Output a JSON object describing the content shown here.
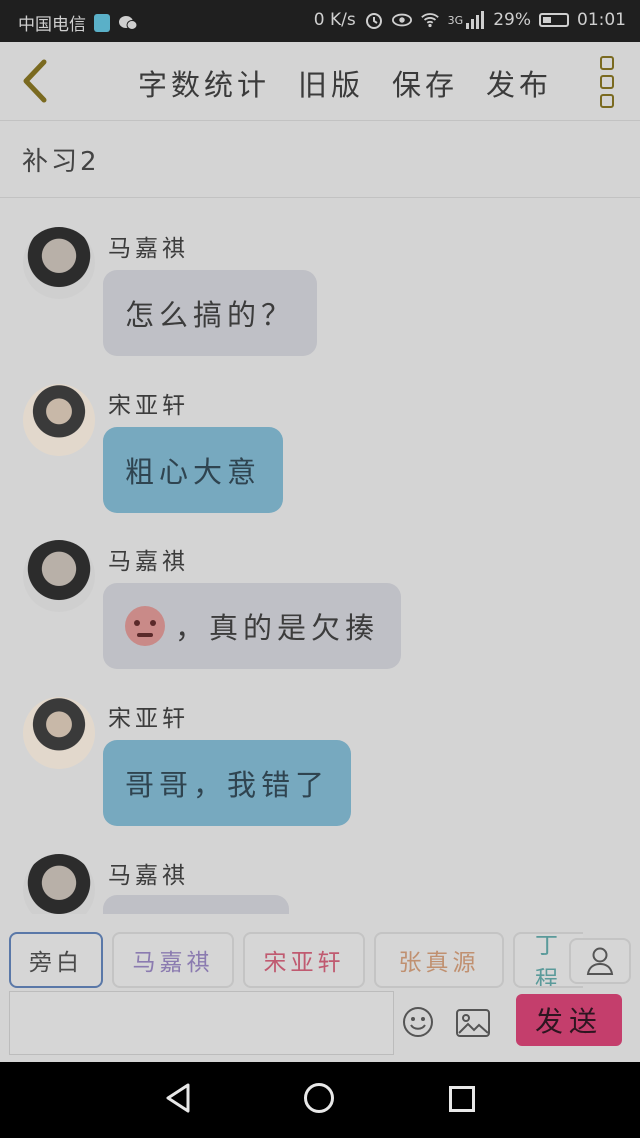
{
  "status": {
    "carrier": "中国电信",
    "speed": "0 K/s",
    "network": "3G",
    "battery_percent": "29%",
    "time": "01:01"
  },
  "header": {
    "actions": [
      "字数统计",
      "旧版",
      "保存",
      "发布"
    ],
    "accent_color": "#7a6a20"
  },
  "chapter_title": "补习2",
  "messages": [
    {
      "speaker": "马嘉祺",
      "text": "怎么搞的？",
      "side": "gray"
    },
    {
      "speaker": "宋亚轩",
      "text": "粗心大意",
      "side": "blue"
    },
    {
      "speaker": "马嘉祺",
      "text": "，真的是欠揍",
      "side": "gray",
      "emoji": "angry-face"
    },
    {
      "speaker": "宋亚轩",
      "text": "哥哥，我错了",
      "side": "blue"
    },
    {
      "speaker": "马嘉祺",
      "text": "",
      "side": "gray"
    }
  ],
  "roles": [
    "旁白",
    "马嘉祺",
    "宋亚轩",
    "张真源",
    "丁程"
  ],
  "input": {
    "placeholder": ""
  },
  "send_label": "发送",
  "colors": {
    "send": "#c43e6c",
    "bubble_gray": "#bfc0c6",
    "bubble_blue": "#77a9bf"
  }
}
